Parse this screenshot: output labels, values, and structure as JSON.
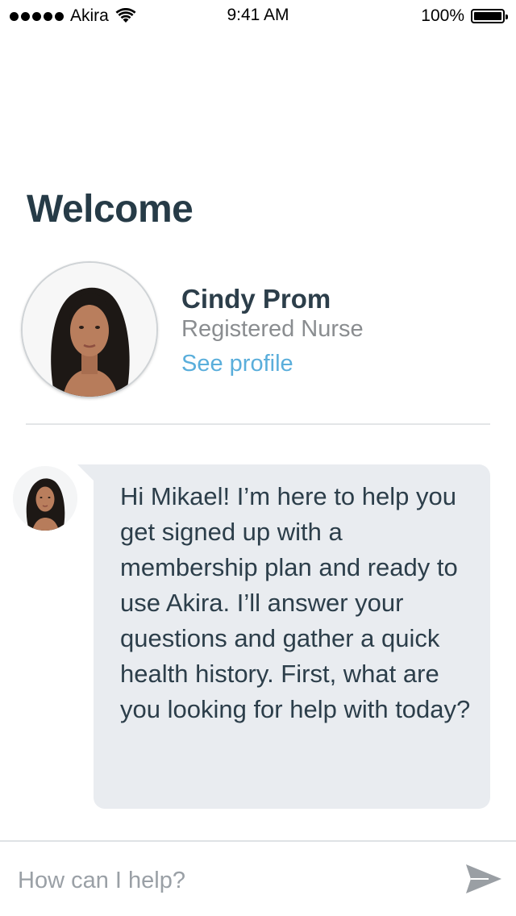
{
  "status_bar": {
    "carrier": "Akira",
    "time": "9:41 AM",
    "battery": "100%",
    "icons": [
      "signal-dots-icon",
      "wifi-icon",
      "battery-icon"
    ]
  },
  "header": {
    "title": "Welcome"
  },
  "profile": {
    "name": "Cindy Prom",
    "role": "Registered Nurse",
    "link_label": "See profile"
  },
  "chat": {
    "messages": [
      {
        "sender": "nurse",
        "text": "Hi Mikael! I’m here to help you get signed up with a membership plan and ready to use Akira. I’ll answer your questions and gather a quick health history. First, what are you looking for help with today?"
      }
    ]
  },
  "composer": {
    "placeholder": "How can I help?",
    "value": "",
    "send_icon": "send-icon"
  },
  "colors": {
    "title": "#263b47",
    "link": "#5aaedb",
    "bubble": "#e9ecf0",
    "muted": "#8a8d90"
  }
}
